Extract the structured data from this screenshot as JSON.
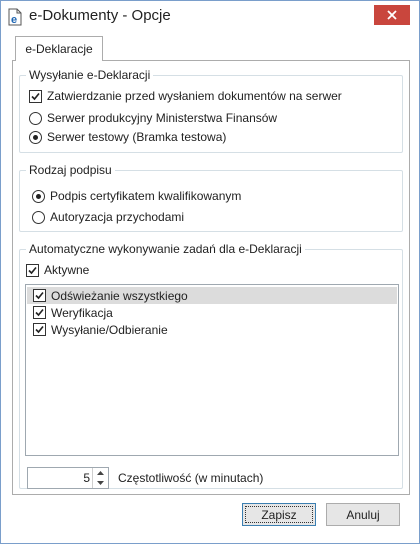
{
  "window": {
    "title": "e-Dokumenty - Opcje",
    "accent": "#c9463d"
  },
  "tab": {
    "label": "e-Deklaracje"
  },
  "group_send": {
    "title": "Wysyłanie e-Deklaracji",
    "confirm_label": "Zatwierdzanie przed wysłaniem dokumentów na serwer",
    "confirm_checked": true,
    "server_production_label": "Serwer produkcyjny Ministerstwa Finansów",
    "server_test_label": "Serwer testowy (Bramka testowa)",
    "selected_server": "test"
  },
  "group_signature": {
    "title": "Rodzaj podpisu",
    "cert_label": "Podpis certyfikatem kwalifikowanym",
    "income_label": "Autoryzacja przychodami",
    "selected": "cert"
  },
  "group_auto": {
    "title": "Automatyczne wykonywanie zadań dla e-Deklaracji",
    "active_label": "Aktywne",
    "active_checked": true,
    "tasks": [
      {
        "label": "Odświeżanie wszystkiego",
        "checked": true,
        "selected": true
      },
      {
        "label": "Weryfikacja",
        "checked": true,
        "selected": false
      },
      {
        "label": "Wysyłanie/Odbieranie",
        "checked": true,
        "selected": false
      }
    ],
    "frequency_value": "5",
    "frequency_label": "Częstotliwość (w minutach)"
  },
  "buttons": {
    "save_label": "Zapisz",
    "cancel_label": "Anuluj"
  }
}
